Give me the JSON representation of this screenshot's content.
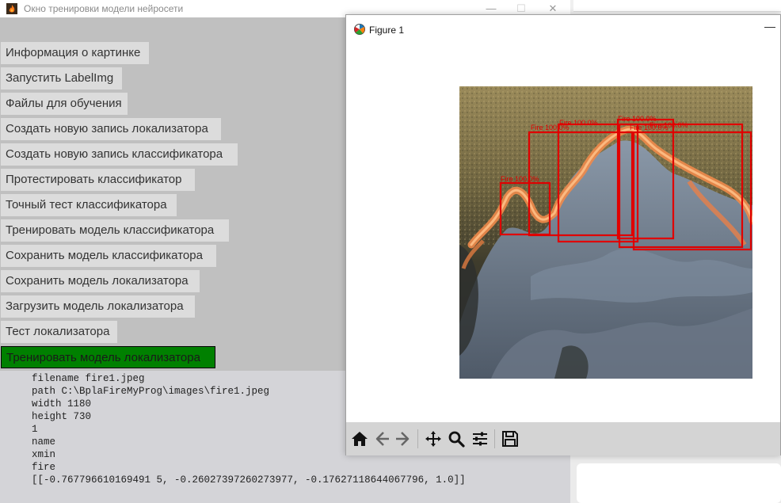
{
  "main_window": {
    "title": "Окно тренировки модели нейросети",
    "controls": {
      "minimize": "—",
      "maximize": "☐",
      "close": "✕"
    }
  },
  "buttons": [
    "Информация о картинке",
    "Запустить LabelImg",
    "Файлы для обучения",
    "Создать новую запись локализатора",
    "Создать новую запись классификатора",
    "Протестировать классификатор",
    "Точный тест классификатора",
    "Тренировать модель классификатора",
    "Сохранить модель классификатора",
    "Сохранить модель локализатора",
    "Загрузить модель локализатора",
    "Тест локализатора",
    "Тренировать модель локализатора"
  ],
  "active_button_index": 12,
  "log_lines": [
    "filename fire1.jpeg",
    "path C:\\BplaFireMyProg\\images\\fire1.jpeg",
    "width 1180",
    "height 730",
    "1",
    "name",
    "xmin",
    "fire",
    "[[-0.767796610169491 5, -0.26027397260273977, -0.17627118644067796, 1.0]]"
  ],
  "figure_window": {
    "title": "Figure 1",
    "minimize": "—",
    "toolbar_icons": [
      "home-icon",
      "back-arrow-icon",
      "forward-arrow-icon",
      "pan-icon",
      "zoom-icon",
      "subplots-config-icon",
      "save-icon"
    ]
  },
  "detections": [
    {
      "label": "Fire 100.0%"
    },
    {
      "label": "Fire 100.0%"
    },
    {
      "label": "Fire 100.0%"
    },
    {
      "label": "Fire 100.0%"
    },
    {
      "label": "Fire 100.0%"
    },
    {
      "label": "Fire 100.0%"
    }
  ],
  "colors": {
    "panel_bg": "#c0c0c0",
    "button_bg": "#dcdcdc",
    "active_button_bg": "#008000",
    "box_color": "#e00000"
  }
}
